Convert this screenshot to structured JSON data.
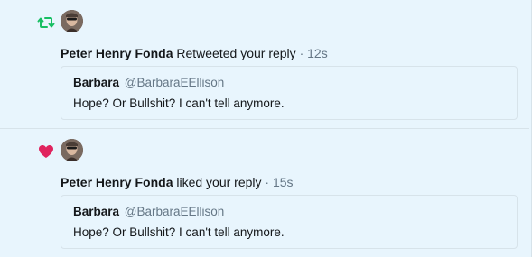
{
  "colors": {
    "background": "#e8f5fd",
    "retweet_green": "#17bf63",
    "like_red": "#e0245e",
    "secondary_text": "#657786",
    "border": "#d7e3ea"
  },
  "notifications": [
    {
      "type_icon": "retweet-icon",
      "actor_name": "Peter Henry Fonda",
      "action": "Retweeted your reply",
      "separator": "·",
      "time": "12s",
      "quoted": {
        "name": "Barbara",
        "handle": "@BarbaraEEllison",
        "text": "Hope? Or Bullshit? I can't tell anymore."
      }
    },
    {
      "type_icon": "heart-icon",
      "actor_name": "Peter Henry Fonda",
      "action": "liked your reply",
      "separator": "·",
      "time": "15s",
      "quoted": {
        "name": "Barbara",
        "handle": "@BarbaraEEllison",
        "text": "Hope? Or Bullshit? I can't tell anymore."
      }
    }
  ]
}
